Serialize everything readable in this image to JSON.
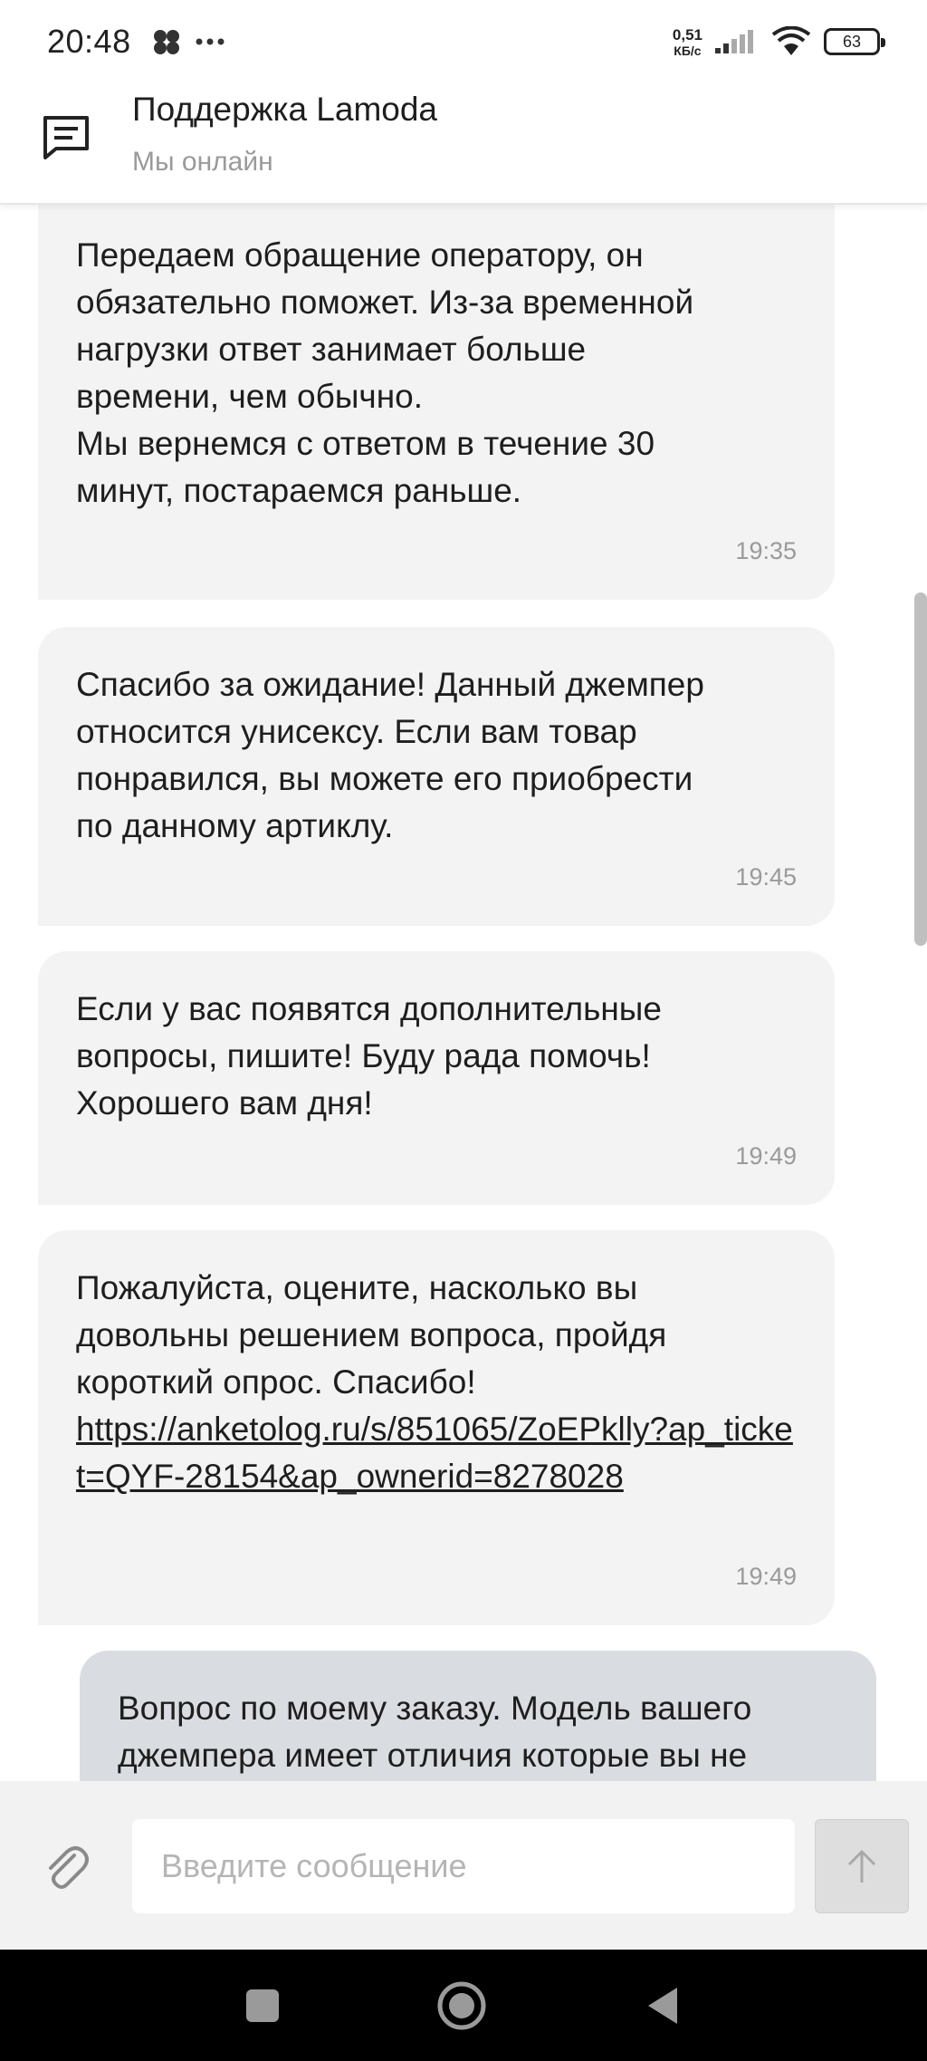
{
  "status_bar": {
    "time": "20:48",
    "network_speed_value": "0,51",
    "network_speed_unit": "КБ/с",
    "battery": "63"
  },
  "header": {
    "title": "Поддержка Lamoda",
    "subtitle": "Мы онлайн"
  },
  "messages": [
    {
      "text": "Передаем обращение оператору, он\nобязательно поможет. Из-за временной\nнагрузки ответ занимает больше\nвремени, чем обычно.\nМы вернемся с ответом в течение 30\nминут, постараемся раньше.",
      "time": "19:35"
    },
    {
      "text": "Спасибо за ожидание! Данный джемпер\nотносится унисексу. Если вам товар\nпонравился, вы можете его приобрести\nпо данному артиклу.",
      "time": "19:45"
    },
    {
      "text": "Если у вас появятся дополнительные\nвопросы, пишите! Буду рада помочь!\nХорошего вам дня!",
      "time": "19:49"
    },
    {
      "text": "Пожалуйста, оцените, насколько вы\nдовольны решением вопроса, пройдя\nкороткий опрос. Спасибо!",
      "link": "https://anketolog.ru/s/851065/ZoEPklly?ap_ticket=QYF-28154&ap_ownerid=8278028",
      "time": "19:49"
    },
    {
      "text": "Вопрос по моему заказу. Модель вашего\nджемпера имеет отличия которые вы не"
    }
  ],
  "composer": {
    "placeholder": "Введите сообщение"
  },
  "icons": {
    "header": "chat-bubble-icon",
    "attach": "paperclip-icon",
    "send": "arrow-up-icon",
    "nav_recent": "square-icon",
    "nav_home": "circle-icon",
    "nav_back": "triangle-back-icon"
  },
  "colors": {
    "bubble_incoming": "#f3f3f3",
    "bubble_outgoing": "#d9dde1",
    "muted_text": "#9a9a9a"
  }
}
